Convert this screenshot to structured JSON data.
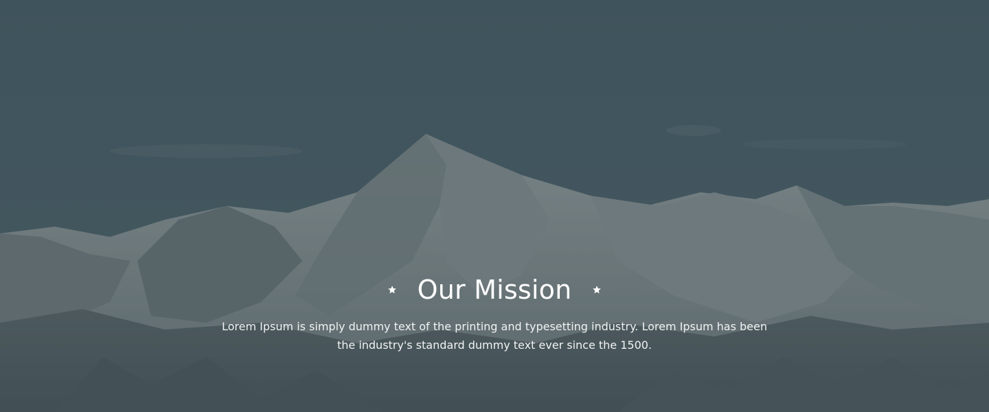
{
  "mission": {
    "title": "Our Mission",
    "description": "Lorem Ipsum is simply dummy text of the printing and typesetting industry. Lorem Ipsum has been the industry's standard dummy text ever since the 1500."
  },
  "decoration": {
    "left_icon": "star-icon",
    "right_icon": "star-icon"
  },
  "colors": {
    "overlay": "#445a62",
    "text": "#ffffff"
  }
}
